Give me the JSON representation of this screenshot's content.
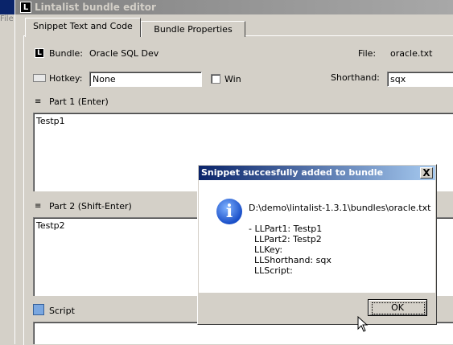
{
  "background_app": {
    "menu": "File"
  },
  "window": {
    "title": "Lintalist bundle editor",
    "icon_letter": "L"
  },
  "tabs": [
    {
      "label": "Snippet Text and Code",
      "active": true
    },
    {
      "label": "Bundle Properties",
      "active": false
    }
  ],
  "form": {
    "bundle_label": "Bundle:",
    "bundle_value": "Oracle SQL Dev",
    "file_label": "File:",
    "file_value": "oracle.txt",
    "hotkey_label": "Hotkey:",
    "hotkey_value": "None",
    "win_label": "Win",
    "shorthand_label": "Shorthand:",
    "shorthand_value": "sqx",
    "part1_label": "Part 1 (Enter)",
    "part1_value": "Testp1",
    "part2_label": "Part 2 (Shift-Enter)",
    "part2_value": "Testp2",
    "script_label": "Script"
  },
  "dialog": {
    "title": "Snippet succesfully added to bundle",
    "close": "X",
    "path": "D:\\demo\\lintalist-1.3.1\\bundles\\oracle.txt",
    "lines": [
      "- LLPart1: Testp1",
      "  LLPart2: Testp2",
      "  LLKey:",
      "  LLShorthand: sqx",
      "  LLScript:"
    ],
    "ok_label": "OK",
    "info_glyph": "i"
  },
  "colors": {
    "title_active": "#0a246a",
    "title_inactive": "#808080",
    "face": "#d4d0c8"
  }
}
